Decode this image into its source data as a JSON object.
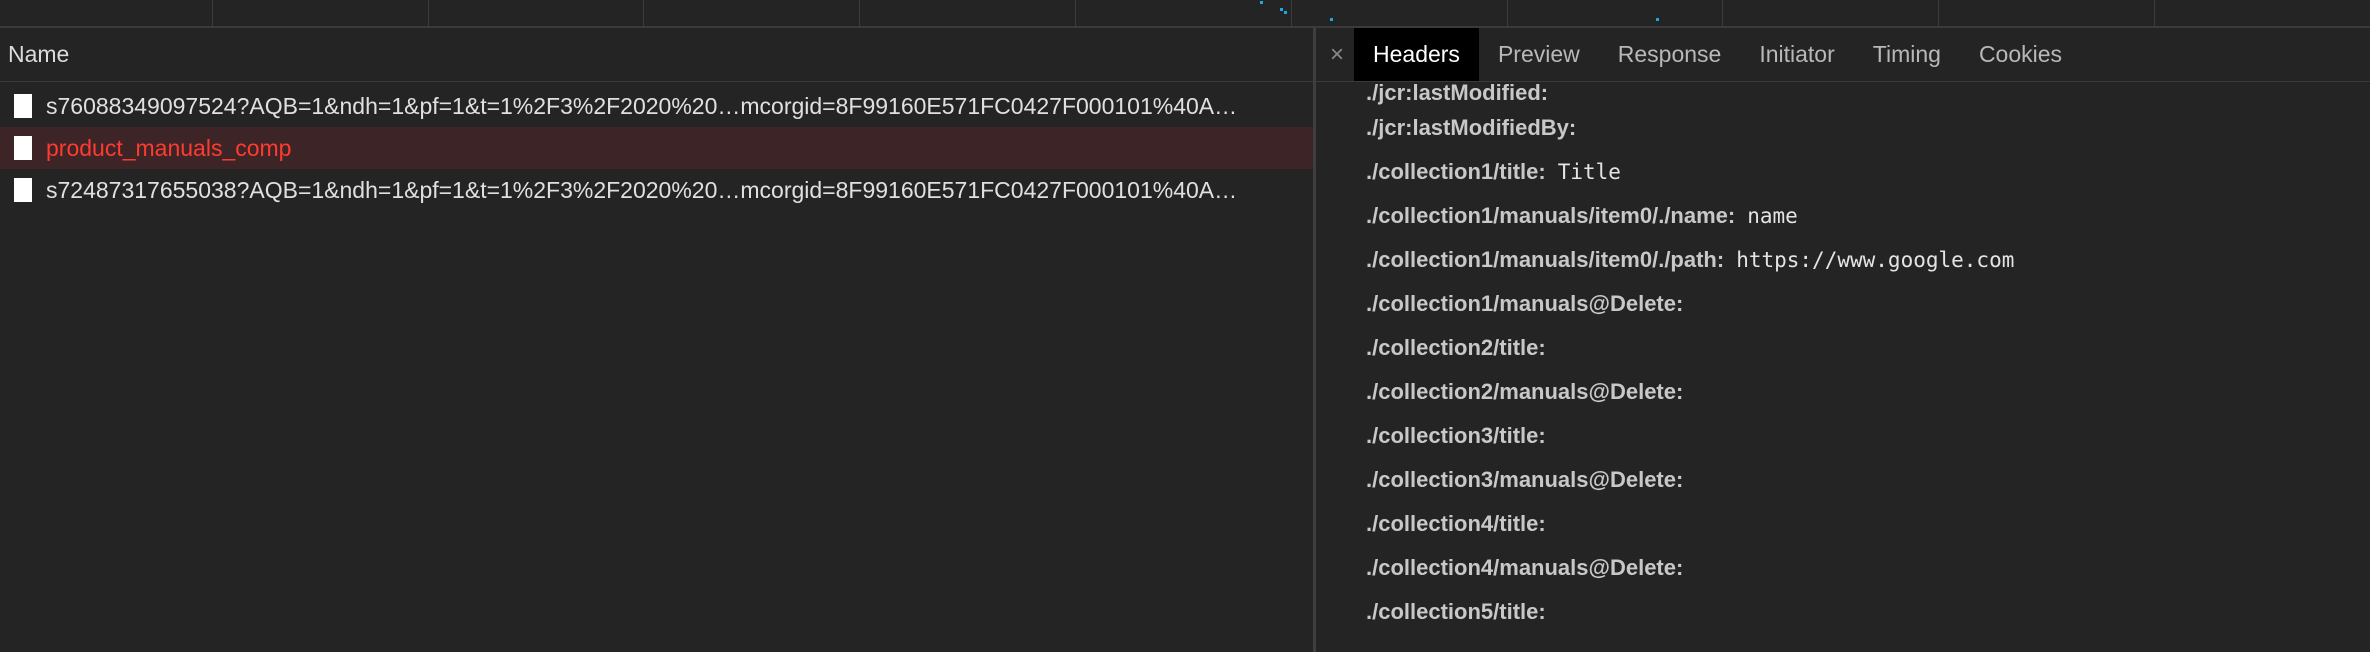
{
  "request_list": {
    "column_header": "Name",
    "rows": [
      {
        "name": "s76088349097524?AQB=1&ndh=1&pf=1&t=1%2F3%2F2020%20…mcorgid=8F99160E571FC0427F000101%40A…",
        "status": "normal"
      },
      {
        "name": "product_manuals_comp",
        "status": "error"
      },
      {
        "name": "s72487317655038?AQB=1&ndh=1&pf=1&t=1%2F3%2F2020%20…mcorgid=8F99160E571FC0427F000101%40A…",
        "status": "normal"
      }
    ]
  },
  "details": {
    "close_icon": "close-icon",
    "tabs": [
      "Headers",
      "Preview",
      "Response",
      "Initiator",
      "Timing",
      "Cookies"
    ],
    "active_tab": "Headers",
    "headers": [
      {
        "key": "./jcr:lastModified:",
        "value": ""
      },
      {
        "key": "./jcr:lastModifiedBy:",
        "value": ""
      },
      {
        "key": "./collection1/title:",
        "value": "Title"
      },
      {
        "key": "./collection1/manuals/item0/./name:",
        "value": "name"
      },
      {
        "key": "./collection1/manuals/item0/./path:",
        "value": "https://www.google.com"
      },
      {
        "key": "./collection1/manuals@Delete:",
        "value": ""
      },
      {
        "key": "./collection2/title:",
        "value": ""
      },
      {
        "key": "./collection2/manuals@Delete:",
        "value": ""
      },
      {
        "key": "./collection3/title:",
        "value": ""
      },
      {
        "key": "./collection3/manuals@Delete:",
        "value": ""
      },
      {
        "key": "./collection4/title:",
        "value": ""
      },
      {
        "key": "./collection4/manuals@Delete:",
        "value": ""
      },
      {
        "key": "./collection5/title:",
        "value": ""
      }
    ]
  },
  "colors": {
    "background": "#242424",
    "error_text": "#ff3b30",
    "error_row_bg": "#3d2426",
    "active_tab_bg": "#000000",
    "timeline_tick": "#1ea7e4"
  }
}
